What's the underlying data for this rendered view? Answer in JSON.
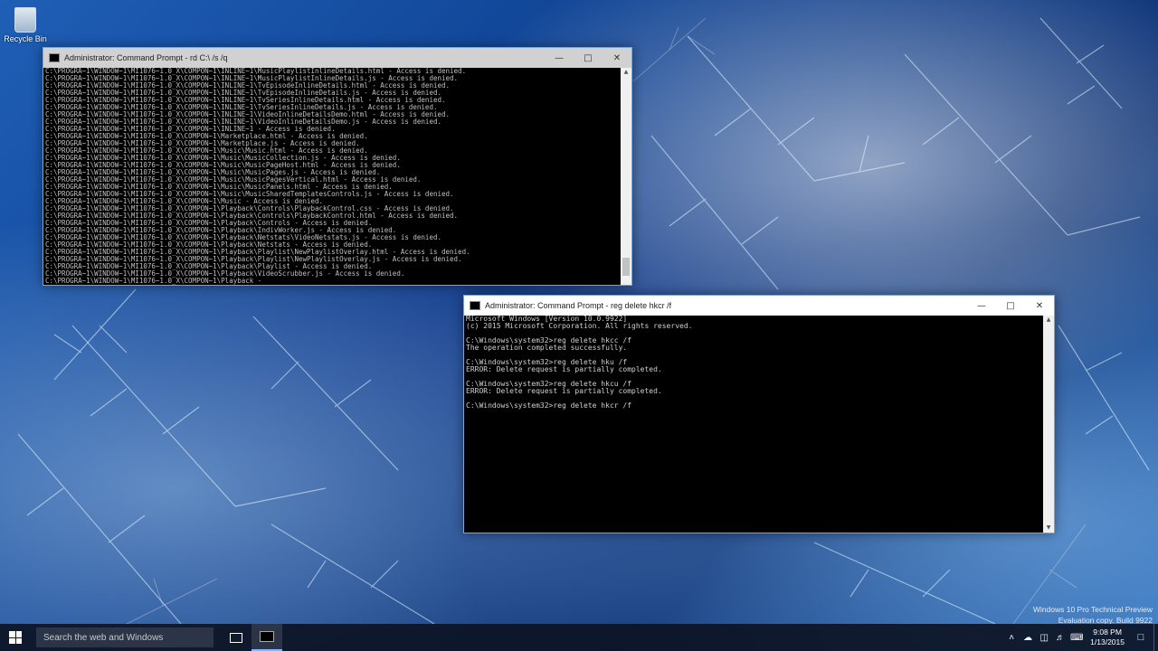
{
  "desktop": {
    "recycle_bin_label": "Recycle Bin",
    "watermark_line1": "Windows 10 Pro Technical Preview",
    "watermark_line2": "Evaluation copy. Build 9922"
  },
  "window1": {
    "title": "Administrator: Command Prompt - rd  C:\\ /s /q",
    "lines": [
      "C:\\PROGRA~1\\WINDOW~1\\MI1076~1.0_X\\COMPON~1\\INLINE~1\\MusicPlaylistInlineDetails.html - Access is denied.",
      "C:\\PROGRA~1\\WINDOW~1\\MI1076~1.0_X\\COMPON~1\\INLINE~1\\MusicPlaylistInlineDetails.js - Access is denied.",
      "C:\\PROGRA~1\\WINDOW~1\\MI1076~1.0_X\\COMPON~1\\INLINE~1\\TvEpisodeInlineDetails.html - Access is denied.",
      "C:\\PROGRA~1\\WINDOW~1\\MI1076~1.0_X\\COMPON~1\\INLINE~1\\TvEpisodeInlineDetails.js - Access is denied.",
      "C:\\PROGRA~1\\WINDOW~1\\MI1076~1.0_X\\COMPON~1\\INLINE~1\\TvSeriesInlineDetails.html - Access is denied.",
      "C:\\PROGRA~1\\WINDOW~1\\MI1076~1.0_X\\COMPON~1\\INLINE~1\\TvSeriesInlineDetails.js - Access is denied.",
      "C:\\PROGRA~1\\WINDOW~1\\MI1076~1.0_X\\COMPON~1\\INLINE~1\\VideoInlineDetailsDemo.html - Access is denied.",
      "C:\\PROGRA~1\\WINDOW~1\\MI1076~1.0_X\\COMPON~1\\INLINE~1\\VideoInlineDetailsDemo.js - Access is denied.",
      "C:\\PROGRA~1\\WINDOW~1\\MI1076~1.0_X\\COMPON~1\\INLINE~1 - Access is denied.",
      "C:\\PROGRA~1\\WINDOW~1\\MI1076~1.0_X\\COMPON~1\\Marketplace.html - Access is denied.",
      "C:\\PROGRA~1\\WINDOW~1\\MI1076~1.0_X\\COMPON~1\\Marketplace.js - Access is denied.",
      "C:\\PROGRA~1\\WINDOW~1\\MI1076~1.0_X\\COMPON~1\\Music\\Music.html - Access is denied.",
      "C:\\PROGRA~1\\WINDOW~1\\MI1076~1.0_X\\COMPON~1\\Music\\MusicCollection.js - Access is denied.",
      "C:\\PROGRA~1\\WINDOW~1\\MI1076~1.0_X\\COMPON~1\\Music\\MusicPageHost.html - Access is denied.",
      "C:\\PROGRA~1\\WINDOW~1\\MI1076~1.0_X\\COMPON~1\\Music\\MusicPages.js - Access is denied.",
      "C:\\PROGRA~1\\WINDOW~1\\MI1076~1.0_X\\COMPON~1\\Music\\MusicPagesVertical.html - Access is denied.",
      "C:\\PROGRA~1\\WINDOW~1\\MI1076~1.0_X\\COMPON~1\\Music\\MusicPanels.html - Access is denied.",
      "C:\\PROGRA~1\\WINDOW~1\\MI1076~1.0_X\\COMPON~1\\Music\\MusicSharedTemplatesControls.js - Access is denied.",
      "C:\\PROGRA~1\\WINDOW~1\\MI1076~1.0_X\\COMPON~1\\Music - Access is denied.",
      "C:\\PROGRA~1\\WINDOW~1\\MI1076~1.0_X\\COMPON~1\\Playback\\Controls\\PlaybackControl.css - Access is denied.",
      "C:\\PROGRA~1\\WINDOW~1\\MI1076~1.0_X\\COMPON~1\\Playback\\Controls\\PlaybackControl.html - Access is denied.",
      "C:\\PROGRA~1\\WINDOW~1\\MI1076~1.0_X\\COMPON~1\\Playback\\Controls - Access is denied.",
      "C:\\PROGRA~1\\WINDOW~1\\MI1076~1.0_X\\COMPON~1\\Playback\\IndivWorker.js - Access is denied.",
      "C:\\PROGRA~1\\WINDOW~1\\MI1076~1.0_X\\COMPON~1\\Playback\\Netstats\\VideoNetstats.js - Access is denied.",
      "C:\\PROGRA~1\\WINDOW~1\\MI1076~1.0_X\\COMPON~1\\Playback\\Netstats - Access is denied.",
      "C:\\PROGRA~1\\WINDOW~1\\MI1076~1.0_X\\COMPON~1\\Playback\\Playlist\\NewPlaylistOverlay.html - Access is denied.",
      "C:\\PROGRA~1\\WINDOW~1\\MI1076~1.0_X\\COMPON~1\\Playback\\Playlist\\NewPlaylistOverlay.js - Access is denied.",
      "C:\\PROGRA~1\\WINDOW~1\\MI1076~1.0_X\\COMPON~1\\Playback\\Playlist - Access is denied.",
      "C:\\PROGRA~1\\WINDOW~1\\MI1076~1.0_X\\COMPON~1\\Playback\\VideoScrubber.js - Access is denied.",
      "C:\\PROGRA~1\\WINDOW~1\\MI1076~1.0_X\\COMPON~1\\Playback -"
    ]
  },
  "window2": {
    "title": "Administrator: Command Prompt - reg  delete hkcr /f",
    "lines": [
      "Microsoft Windows [Version 10.0.9922]",
      "(c) 2015 Microsoft Corporation. All rights reserved.",
      "",
      "C:\\Windows\\system32>reg delete hkcc /f",
      "The operation completed successfully.",
      "",
      "C:\\Windows\\system32>reg delete hku /f",
      "ERROR: Delete request is partially completed.",
      "",
      "C:\\Windows\\system32>reg delete hkcu /f",
      "ERROR: Delete request is partially completed.",
      "",
      "C:\\Windows\\system32>reg delete hkcr /f"
    ]
  },
  "taskbar": {
    "search_placeholder": "Search the web and Windows",
    "time": "9:08 PM",
    "date": "1/13/2015"
  }
}
